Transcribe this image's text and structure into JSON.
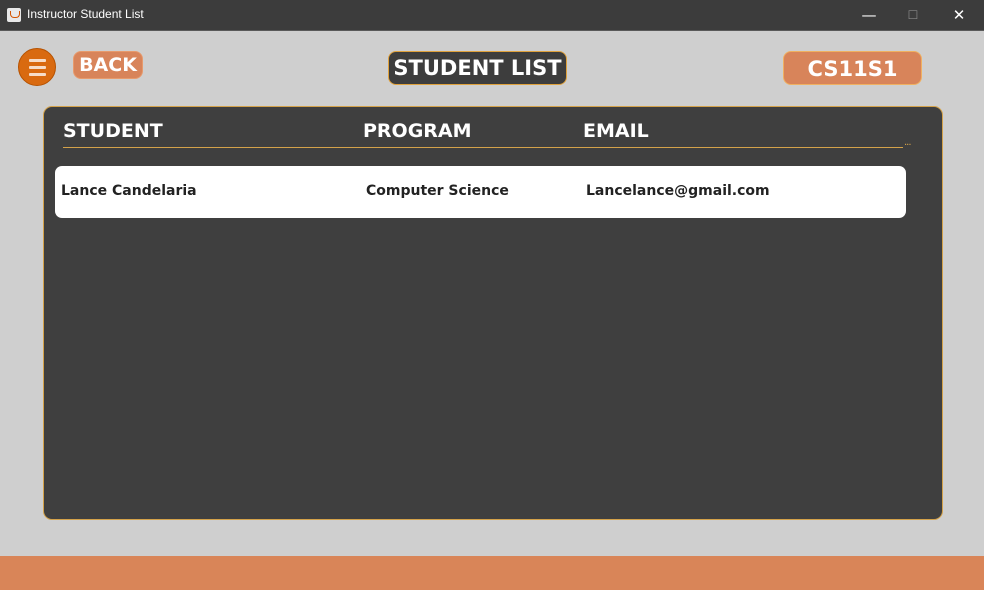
{
  "window": {
    "title": "Instructor Student List",
    "controls": {
      "minimize": "—",
      "maximize": "☐",
      "close": "✕"
    }
  },
  "header": {
    "menu_icon": "hamburger-menu-icon",
    "back_label": "BACK",
    "page_title": "STUDENT LIST",
    "section_code": "CS11S1"
  },
  "table": {
    "columns": [
      "STUDENT",
      "PROGRAM",
      "EMAIL"
    ],
    "rows": [
      {
        "student": "Lance Candelaria",
        "program": "Computer Science",
        "email": "Lancelance@gmail.com"
      }
    ],
    "overflow_indicator": "..."
  },
  "colors": {
    "background": "#cfcfcf",
    "titlebar": "#3c3c3c",
    "accent_orange": "#d8845a",
    "menu_orange": "#d96a10",
    "panel": "#3f3f3f",
    "panel_border": "#d4a24a",
    "row_background": "#ffffff"
  }
}
